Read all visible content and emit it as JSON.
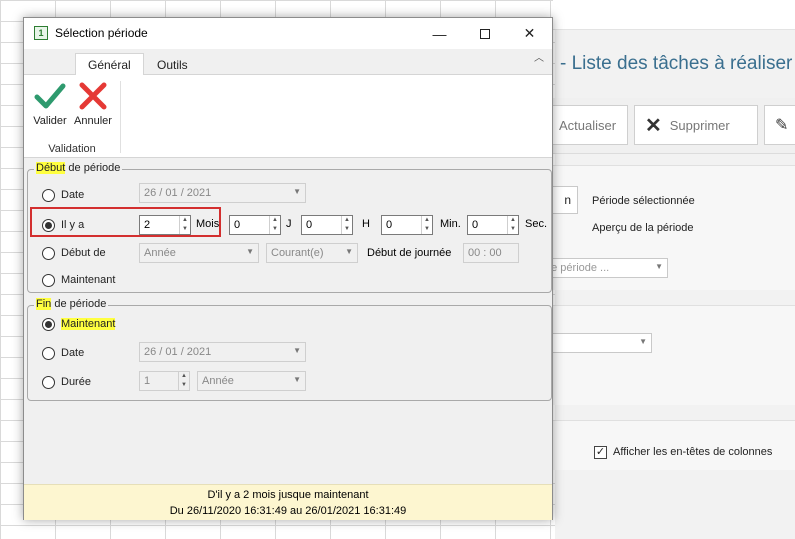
{
  "background": {
    "title": "- Liste des tâches à réaliser",
    "buttons": {
      "refresh": "Actualiser",
      "delete": "Supprimer"
    },
    "period_button": "n",
    "labels": {
      "selected_period": "Période sélectionnée",
      "period_preview": "Aperçu de la période"
    },
    "select_placeholder": "ne période ...",
    "show_headers": "Afficher les en-têtes de colonnes",
    "show_headers_checked": true
  },
  "dialog": {
    "title": "Sélection période",
    "window_controls": [
      "minimize-icon",
      "maximize-icon",
      "close-icon"
    ],
    "tabs": [
      {
        "label": "Général",
        "active": true
      },
      {
        "label": "Outils",
        "active": false
      }
    ],
    "ribbon": {
      "validate_label": "Valider",
      "cancel_label": "Annuler",
      "group_label": "Validation"
    },
    "start": {
      "title_highlight": "Début",
      "title_rest": " de période",
      "date_label": "Date",
      "date_value": "26 / 01 / 2021",
      "ago_label": "Il y a",
      "ago_months": "2",
      "unit_months": "Mois",
      "ago_days": "0",
      "unit_days": "J",
      "ago_hours": "0",
      "unit_hours": "H",
      "ago_minutes": "0",
      "unit_minutes": "Min.",
      "ago_seconds": "0",
      "unit_seconds": "Sec.",
      "start_of_label": "Début de",
      "start_of_unit": "Année",
      "start_of_which": "Courant(e)",
      "day_start_label": "Début de journée",
      "day_start_time": "00 : 00",
      "now_label": "Maintenant",
      "selected": "ago"
    },
    "end": {
      "title_highlight": "Fin",
      "title_rest": " de période",
      "now_label": "Maintenant",
      "date_label": "Date",
      "date_value": "26 / 01 / 2021",
      "duration_label": "Durée",
      "duration_value": "1",
      "duration_unit": "Année",
      "selected": "now"
    },
    "status": {
      "line1": "D'il y a 2 mois jusque maintenant",
      "line2": "Du 26/11/2020 16:31:49 au 26/01/2021 16:31:49"
    }
  },
  "colors": {
    "highlight": "#ffff40",
    "red_box": "#d32f2f",
    "validate_green": "#2e9a6e",
    "cancel_red": "#e53935",
    "status_bg": "#fdf6d0",
    "bg_title": "#3a6f8f"
  }
}
